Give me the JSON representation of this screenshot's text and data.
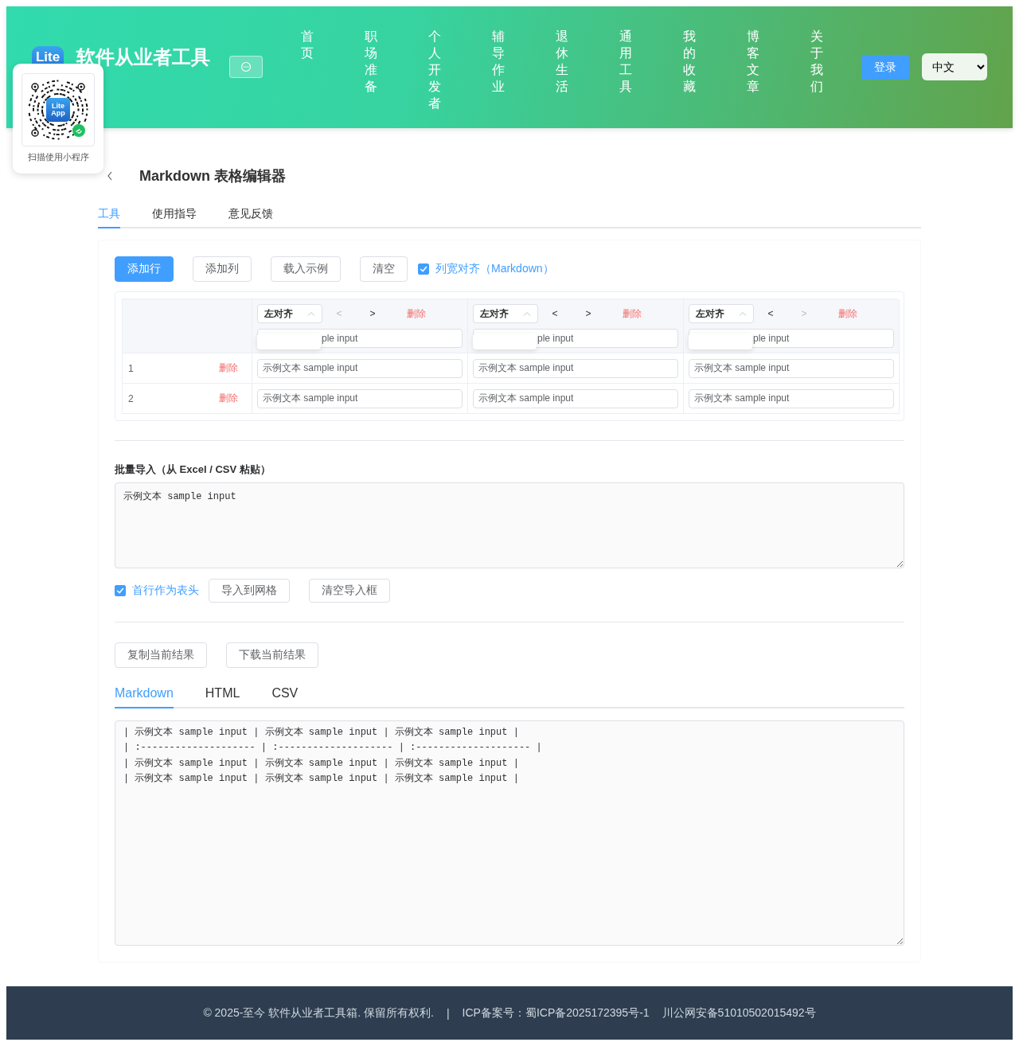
{
  "header": {
    "logo_text": "Lite",
    "title": "软件从业者工具",
    "nav": [
      {
        "label": "首页"
      },
      {
        "label": "职场准备"
      },
      {
        "label": "个人开发者"
      },
      {
        "label": "辅导作业"
      },
      {
        "label": "退休生活"
      },
      {
        "label": "通用工具"
      },
      {
        "label": "我的收藏"
      },
      {
        "label": "博客文章"
      },
      {
        "label": "关于我们"
      }
    ],
    "login": "登录",
    "language": "中文"
  },
  "qr_popup": {
    "badge": [
      "Lite",
      "App"
    ],
    "caption": "扫描使用小程序"
  },
  "page": {
    "title": "Markdown 表格编辑器",
    "tabs": [
      {
        "label": "工具",
        "selected": true
      },
      {
        "label": "使用指导",
        "selected": false
      },
      {
        "label": "意见反馈",
        "selected": false
      }
    ]
  },
  "toolbar": {
    "buttons": [
      {
        "label": "添加行",
        "primary": true
      },
      {
        "label": "添加列",
        "primary": false
      },
      {
        "label": "载入示例",
        "primary": false
      },
      {
        "label": "清空",
        "primary": false
      }
    ],
    "align_option": {
      "label": "列宽对齐（Markdown）",
      "checked": true
    }
  },
  "grid": {
    "columns": [
      {
        "align": "左对齐",
        "dropdown_open": true,
        "prev": "<",
        "next": ">",
        "prev_disabled": true,
        "next_disabled": false,
        "delete": "删除",
        "header_value": "ple input"
      },
      {
        "align": "左对齐",
        "dropdown_open": true,
        "prev": "<",
        "next": ">",
        "prev_disabled": false,
        "next_disabled": false,
        "delete": "删除",
        "header_value": "ple input"
      },
      {
        "align": "左对齐",
        "dropdown_open": true,
        "prev": "<",
        "next": ">",
        "prev_disabled": false,
        "next_disabled": true,
        "delete": "删除",
        "header_value": "ple input"
      }
    ],
    "rows": [
      {
        "number": "1",
        "delete": "删除",
        "cells": [
          "示例文本 sample input",
          "示例文本 sample input",
          "示例文本 sample input"
        ]
      },
      {
        "number": "2",
        "delete": "删除",
        "cells": [
          "示例文本 sample input",
          "示例文本 sample input",
          "示例文本 sample input"
        ]
      }
    ]
  },
  "import": {
    "label": "批量导入（从 Excel / CSV 粘贴）",
    "value": "示例文本 sample input",
    "header_option": {
      "label": "首行作为表头",
      "checked": true
    },
    "buttons": [
      "导入到网格",
      "清空导入框"
    ]
  },
  "output": {
    "buttons": [
      "复制当前结果",
      "下载当前结果"
    ],
    "tabs": [
      {
        "label": "Markdown",
        "selected": true
      },
      {
        "label": "HTML",
        "selected": false
      },
      {
        "label": "CSV",
        "selected": false
      }
    ],
    "value": "| 示例文本 sample input | 示例文本 sample input | 示例文本 sample input |\n| :-------------------- | :-------------------- | :-------------------- |\n| 示例文本 sample input | 示例文本 sample input | 示例文本 sample input |\n| 示例文本 sample input | 示例文本 sample input | 示例文本 sample input |"
  },
  "footer": {
    "copyright": "© 2025-至今 软件从业者工具箱. 保留所有权利.",
    "separator": "|",
    "icp": "ICP备案号：蜀ICP备2025172395号-1",
    "police": "川公网安备51010502015492号"
  }
}
